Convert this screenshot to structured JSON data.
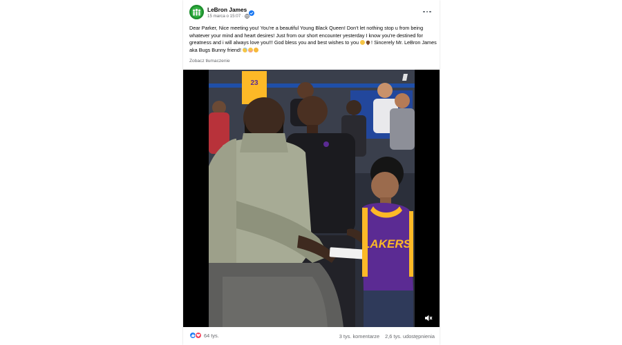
{
  "post": {
    "author": "LeBron James",
    "timestamp": "15 marca o 15:07",
    "separator": "·",
    "text_main": "Dear Parker, Nice meeting you! You're a beautiful Young Black Queen! Don't let nothing stop u from being whatever your mind and heart desires! Just from our short encounter yesterday I know you're destined for greatness and i will always love you!!! God bless you and best wishes to you ",
    "text_end": "! Sincerely Mr. LeBron James aka Bugs Bunny friend! ",
    "translate_label": "Zobacz tłumaczenie",
    "jersey_top_number": "23",
    "jersey_word": "LAKERS",
    "reaction_count": "64 tys.",
    "comments": "3 tys. komentarze",
    "shares": "2,6 tys. udostępnienia"
  },
  "icons": {
    "verified": "verified-badge-icon",
    "audience": "globe-icon",
    "more": "more-options-icon",
    "mute": "volume-muted-icon",
    "like": "like-reaction-icon",
    "love": "love-reaction-icon"
  },
  "colors": {
    "verified": "#1877f2",
    "like": "#1877f2",
    "love": "#f33e58",
    "jersey_purple": "#5b2b93",
    "jersey_gold": "#fdb927"
  }
}
